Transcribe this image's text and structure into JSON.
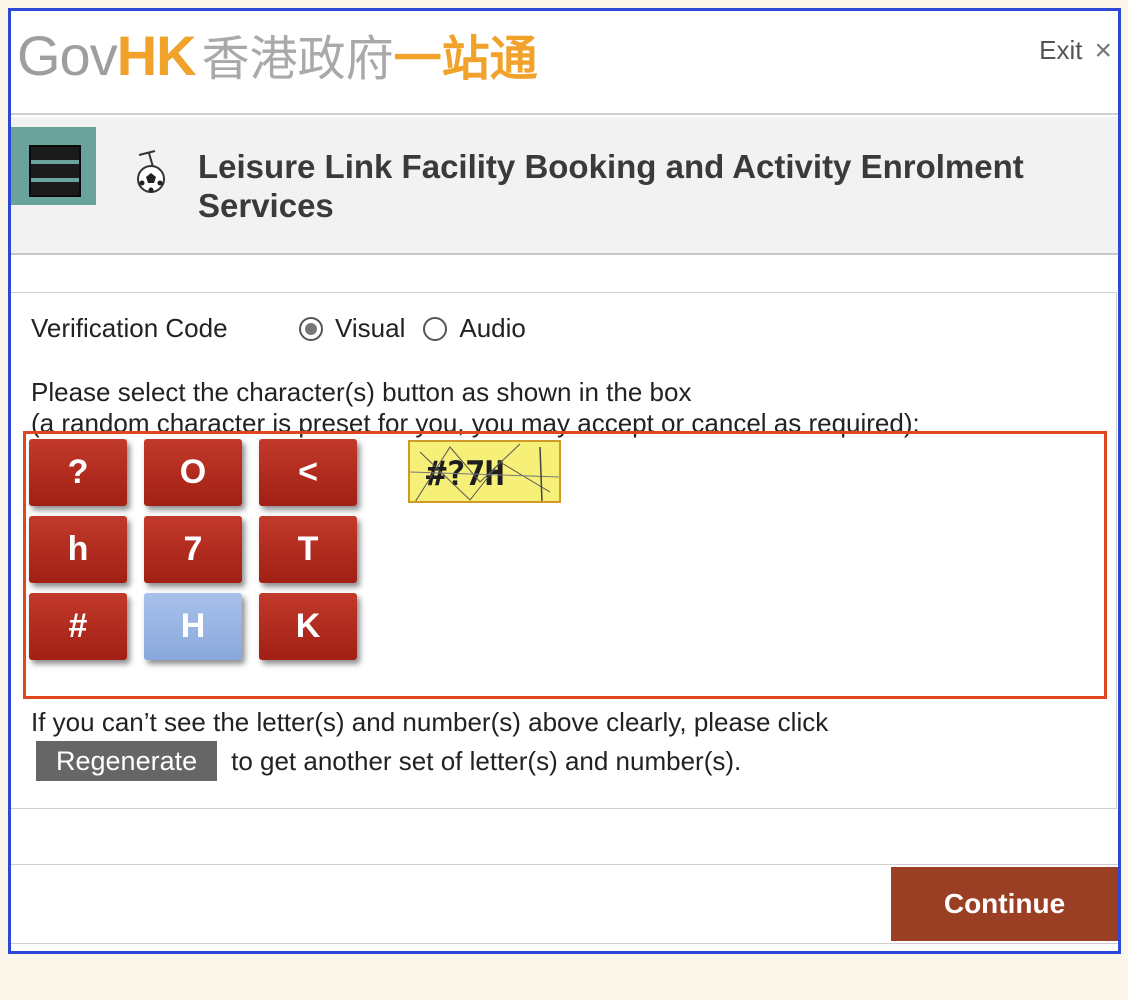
{
  "header": {
    "logo_gov": "Gov",
    "logo_hk": "HK",
    "logo_cn_gray": "香港政府",
    "logo_cn_orange": "一站通",
    "exit_label": "Exit",
    "exit_icon": "×"
  },
  "titlebar": {
    "title": "Leisure Link Facility Booking and Activity Enrolment Services",
    "menu_icon": "hamburger-menu-icon",
    "service_icon": "sports-icon"
  },
  "verification": {
    "label": "Verification Code",
    "options": [
      {
        "label": "Visual",
        "checked": true
      },
      {
        "label": "Audio",
        "checked": false
      }
    ],
    "instruction_line1": "Please select the character(s) button as shown in the box",
    "instruction_line2": "(a random character is preset for you, you may accept or cancel as required):",
    "keys": [
      {
        "char": "?",
        "selected": false
      },
      {
        "char": "O",
        "selected": false
      },
      {
        "char": "<",
        "selected": false
      },
      {
        "char": "h",
        "selected": false
      },
      {
        "char": "7",
        "selected": false
      },
      {
        "char": "T",
        "selected": false
      },
      {
        "char": "#",
        "selected": false
      },
      {
        "char": "H",
        "selected": true
      },
      {
        "char": "K",
        "selected": false
      }
    ],
    "captcha_text": "#?7H",
    "help_line1": "If you can’t see the letter(s) and number(s) above clearly, please click",
    "regenerate_label": "Regenerate",
    "help_line2": "to get another set of letter(s) and number(s)."
  },
  "footer": {
    "continue_label": "Continue"
  },
  "colors": {
    "frame_border": "#2b49d6",
    "highlight_border": "#e0471e",
    "key_red": "#b02a1c",
    "key_selected": "#9ab5e4",
    "continue_bg": "#9b3f24",
    "logo_orange": "#f0a22a"
  }
}
